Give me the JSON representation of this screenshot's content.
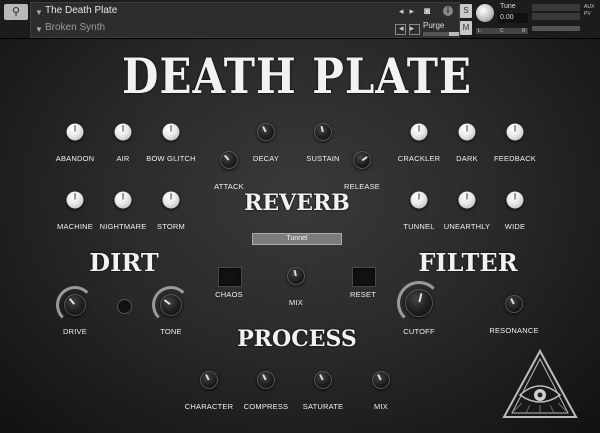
{
  "header": {
    "instrument_name": "The Death Plate",
    "sub_name": "Broken Synth",
    "purge_label": "Purge",
    "s_label": "S",
    "m_label": "M",
    "tune_label": "Tune",
    "tune_value": "0.00",
    "pan_left": "L",
    "pan_center": "C",
    "pan_right": "R",
    "aux_label": "AUX",
    "pv_label": "PV"
  },
  "title": "DEATH PLATE",
  "sections": {
    "reverb": "REVERB",
    "dirt": "DIRT",
    "filter": "FILTER",
    "process": "PROCESS"
  },
  "reverb": {
    "preset": "Tunnel",
    "knobs_left": [
      {
        "label": "ABANDON",
        "value": 0.5
      },
      {
        "label": "AIR",
        "value": 0.5
      },
      {
        "label": "BOW GLITCH",
        "value": 0.5
      },
      {
        "label": "MACHINE",
        "value": 0.5
      },
      {
        "label": "NIGHTMARE",
        "value": 0.5
      },
      {
        "label": "STORM",
        "value": 0.5
      }
    ],
    "knobs_center": [
      {
        "label": "DECAY",
        "value": 0.4
      },
      {
        "label": "SUSTAIN",
        "value": 0.45
      },
      {
        "label": "ATTACK",
        "value": 0.35
      },
      {
        "label": "RELEASE",
        "value": 0.7
      }
    ],
    "knobs_right": [
      {
        "label": "CRACKLER",
        "value": 0.5
      },
      {
        "label": "DARK",
        "value": 0.5
      },
      {
        "label": "FEEDBACK",
        "value": 0.5
      },
      {
        "label": "TUNNEL",
        "value": 0.5
      },
      {
        "label": "UNEARTHLY",
        "value": 0.5
      },
      {
        "label": "WIDE",
        "value": 0.5
      }
    ]
  },
  "dirt": {
    "drive_label": "DRIVE",
    "drive_value": 0.35,
    "tone_label": "TONE",
    "tone_value": 0.3
  },
  "center_controls": {
    "chaos_label": "CHAOS",
    "mix_label": "MIX",
    "mix_value": 0.45,
    "reset_label": "RESET"
  },
  "filter": {
    "cutoff_label": "CUTOFF",
    "cutoff_value": 0.55,
    "resonance_label": "RESONANCE",
    "resonance_value": 0.4
  },
  "process": {
    "knobs": [
      {
        "label": "CHARACTER",
        "value": 0.4
      },
      {
        "label": "COMPRESS",
        "value": 0.4
      },
      {
        "label": "SATURATE",
        "value": 0.4
      },
      {
        "label": "MIX",
        "value": 0.4
      }
    ]
  },
  "colors": {
    "background": "#2a2a2a",
    "knob_white": "#f0f0f0",
    "knob_black": "#1e1e1e",
    "text": "#f0f0f0"
  }
}
